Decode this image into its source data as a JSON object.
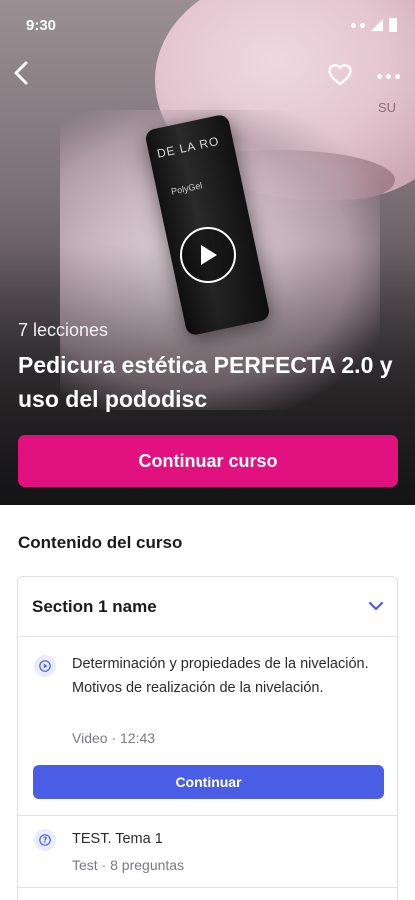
{
  "status_bar": {
    "time": "9:30"
  },
  "hero": {
    "lessons_count": "7 lecciones",
    "course_title": "Pedicura estética PERFECTA 2.0 y uso del pododisc",
    "cta_label": "Continuar curso",
    "product_brand": "DE LA RO",
    "product_name": "PolyGel",
    "lamp_text": "SU"
  },
  "content": {
    "heading": "Contenido del curso",
    "section": {
      "title": "Section 1 name",
      "lessons": [
        {
          "icon": "play-icon",
          "text": "Determinación y propiedades de la nivelación. Motivos de realización de la nivelación.",
          "meta": "Video · 12:43"
        },
        {
          "icon": "question-icon",
          "text": "TEST. Tema 1",
          "meta": "Test · 8 preguntas"
        }
      ],
      "continue_label": "Continuar"
    }
  },
  "colors": {
    "primary_cta": "#e1127f",
    "secondary_cta": "#4a5ee5",
    "icon_accent": "#4a5ee5"
  }
}
